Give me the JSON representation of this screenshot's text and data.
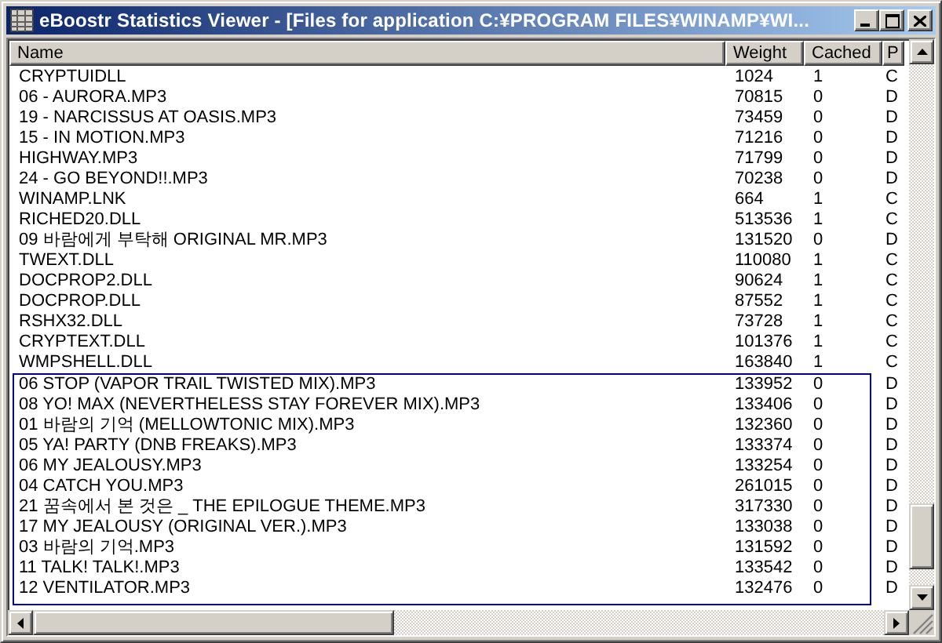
{
  "window": {
    "title": "eBoostr Statistics Viewer - [Files for application C:¥PROGRAM FILES¥WINAMP¥WI..."
  },
  "table": {
    "columns": [
      "Name",
      "Weight",
      "Cached",
      "P"
    ],
    "rows": [
      [
        "CRYPTUIDLL",
        "1024",
        "1",
        "C"
      ],
      [
        "06 - AURORA.MP3",
        "70815",
        "0",
        "D"
      ],
      [
        "19 - NARCISSUS AT OASIS.MP3",
        "73459",
        "0",
        "D"
      ],
      [
        "15 - IN MOTION.MP3",
        "71216",
        "0",
        "D"
      ],
      [
        "HIGHWAY.MP3",
        "71799",
        "0",
        "D"
      ],
      [
        "24 - GO BEYOND!!.MP3",
        "70238",
        "0",
        "D"
      ],
      [
        "WINAMP.LNK",
        "664",
        "1",
        "C"
      ],
      [
        "RICHED20.DLL",
        "513536",
        "1",
        "C"
      ],
      [
        "09 바람에게 부탁해 ORIGINAL MR.MP3",
        "131520",
        "0",
        "D"
      ],
      [
        "TWEXT.DLL",
        "110080",
        "1",
        "C"
      ],
      [
        "DOCPROP2.DLL",
        "90624",
        "1",
        "C"
      ],
      [
        "DOCPROP.DLL",
        "87552",
        "1",
        "C"
      ],
      [
        "RSHX32.DLL",
        "73728",
        "1",
        "C"
      ],
      [
        "CRYPTEXT.DLL",
        "101376",
        "1",
        "C"
      ],
      [
        "WMPSHELL.DLL",
        "163840",
        "1",
        "C"
      ]
    ],
    "framed_rows": [
      [
        "06 STOP (VAPOR TRAIL TWISTED MIX).MP3",
        "133952",
        "0",
        "D"
      ],
      [
        "08 YO! MAX (NEVERTHELESS STAY FOREVER MIX).MP3",
        "133406",
        "0",
        "D"
      ],
      [
        "01 바람의 기억 (MELLOWTONIC MIX).MP3",
        "132360",
        "0",
        "D"
      ],
      [
        "05 YA! PARTY (DNB FREAKS).MP3",
        "133374",
        "0",
        "D"
      ],
      [
        "06 MY JEALOUSY.MP3",
        "133254",
        "0",
        "D"
      ],
      [
        "04 CATCH YOU.MP3",
        "261015",
        "0",
        "D"
      ],
      [
        "21 꿈속에서 본 것은 _ THE EPILOGUE THEME.MP3",
        "317330",
        "0",
        "D"
      ],
      [
        "17 MY JEALOUSY (ORIGINAL VER.).MP3",
        "133038",
        "0",
        "D"
      ],
      [
        "03 바람의 기억.MP3",
        "131592",
        "0",
        "D"
      ],
      [
        "11 TALK! TALK!.MP3",
        "133542",
        "0",
        "D"
      ],
      [
        "12 VENTILATOR.MP3",
        "132476",
        "0",
        "D"
      ]
    ]
  }
}
